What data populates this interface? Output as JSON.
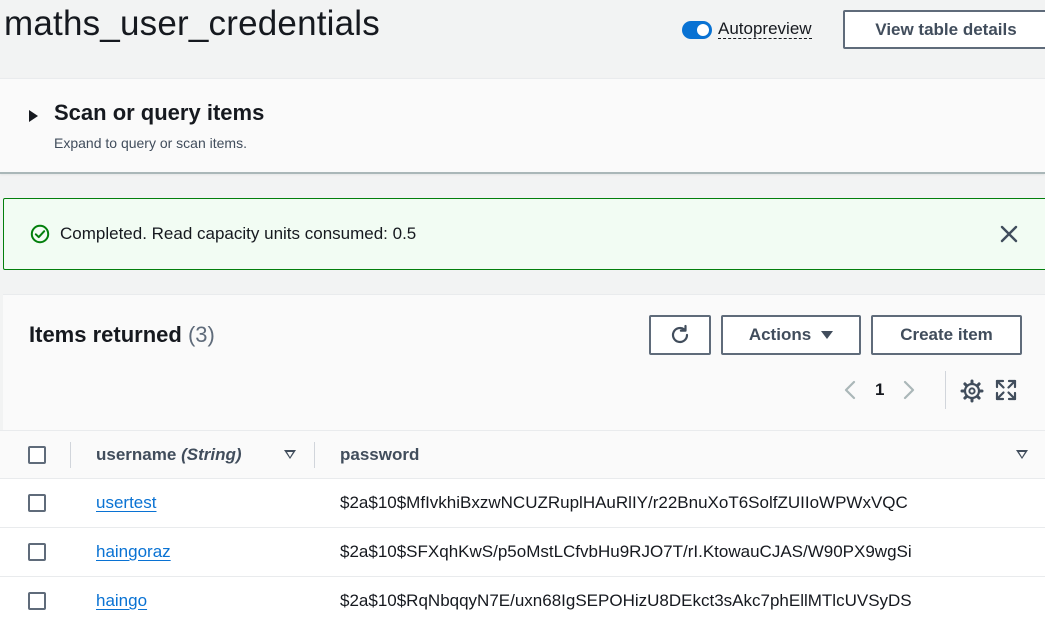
{
  "header": {
    "title": "maths_user_credentials",
    "autopreview_label": "Autopreview",
    "autopreview_on": true,
    "view_details_label": "View table details"
  },
  "scan": {
    "title": "Scan or query items",
    "subtitle": "Expand to query or scan items."
  },
  "flash": {
    "message": "Completed. Read capacity units consumed: 0.5",
    "status_color": "#037f0c"
  },
  "items": {
    "title": "Items returned",
    "count": "(3)",
    "actions_label": "Actions",
    "create_label": "Create item",
    "page": "1",
    "columns": [
      {
        "name": "username",
        "type": "(String)"
      },
      {
        "name": "password"
      }
    ],
    "rows": [
      {
        "username": "usertest",
        "password": "$2a$10$MfIvkhiBxzwNCUZRuplHAuRlIY/r22BnuXoT6SolfZUIIoWPWxVQC"
      },
      {
        "username": "haingoraz",
        "password": "$2a$10$SFXqhKwS/p5oMstLCfvbHu9RJO7T/rI.KtowauCJAS/W90PX9wgSi"
      },
      {
        "username": "haingo",
        "password": "$2a$10$RqNbqqyN7E/uxn68IgSEPOHizU8DEkct3sAkc7phEllMTlcUVSyDS"
      }
    ]
  },
  "colors": {
    "link": "#0972d3",
    "toggle": "#0972d3",
    "success": "#037f0c"
  }
}
